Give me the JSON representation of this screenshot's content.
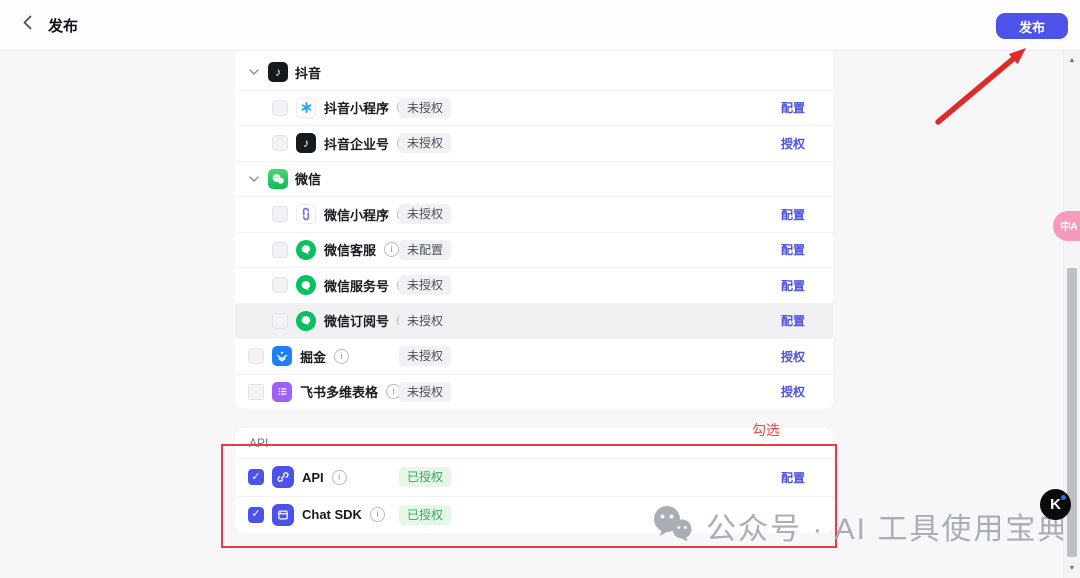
{
  "header": {
    "title": "发布",
    "publish_label": "发布"
  },
  "channels": {
    "rows": [
      {
        "kind": "group",
        "name": "抖音"
      },
      {
        "kind": "item",
        "name": "抖音小程序",
        "status": "未授权",
        "action": "配置"
      },
      {
        "kind": "item",
        "name": "抖音企业号",
        "status": "未授权",
        "action": "授权"
      },
      {
        "kind": "group",
        "name": "微信"
      },
      {
        "kind": "item",
        "name": "微信小程序",
        "status": "未授权",
        "action": "配置"
      },
      {
        "kind": "item",
        "name": "微信客服",
        "status": "未配置",
        "action": "配置"
      },
      {
        "kind": "item",
        "name": "微信服务号",
        "status": "未授权",
        "action": "配置"
      },
      {
        "kind": "item",
        "name": "微信订阅号",
        "status": "未授权",
        "action": "配置"
      },
      {
        "kind": "item",
        "name": "掘金",
        "status": "未授权",
        "action": "授权"
      },
      {
        "kind": "item",
        "name": "飞书多维表格",
        "status": "未授权",
        "action": "授权"
      }
    ]
  },
  "api_section": {
    "label": "API",
    "rows": [
      {
        "name": "API",
        "status": "已授权",
        "action": "配置",
        "checked": true
      },
      {
        "name": "Chat SDK",
        "status": "已授权",
        "checked": true
      }
    ]
  },
  "annotations": {
    "highlight_label": "勾选"
  },
  "watermark": {
    "text": "公众号 · AI 工具使用宝典"
  },
  "floating": {
    "translate_label": "中A",
    "k_label": "K"
  },
  "colors": {
    "accent": "#4D53E8",
    "annotation_red": "#EC3B41",
    "status_green_text": "#35AB53",
    "status_green_bg": "#E6F7EA",
    "status_gray_bg": "#F1F1F5",
    "wechat_green": "#07C160",
    "juejin_blue": "#1E80FF",
    "feishu_purple": "#9E61F5"
  }
}
